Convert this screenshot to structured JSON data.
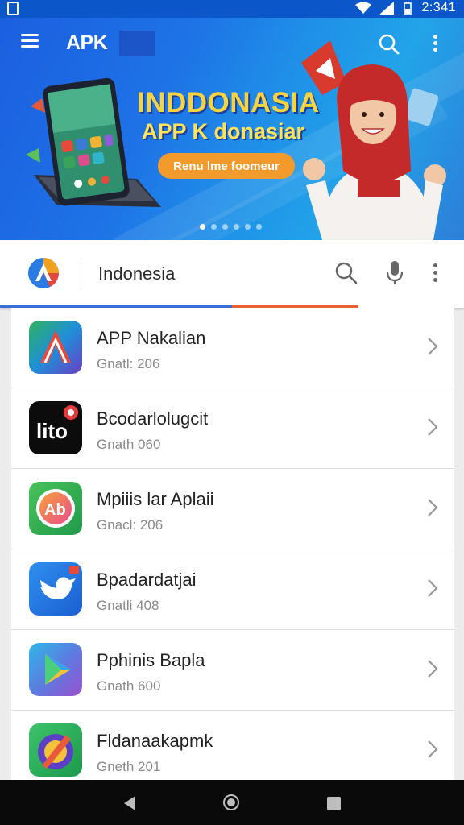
{
  "status_bar": {
    "time": "2:341"
  },
  "banner": {
    "logo": "APK",
    "headline": "INDDONASIA",
    "subline": "APP K donasiar",
    "button_label": "Renu lme foomeur",
    "slides": 6,
    "active_slide": 1
  },
  "search": {
    "query": "Indonesia"
  },
  "apps": [
    {
      "name": "APP Nakalian",
      "meta": "Gnatl: 206",
      "icon": "app-a-icon"
    },
    {
      "name": "Bcodarlolugcit",
      "meta": "Gnath 060",
      "icon": "lito-icon"
    },
    {
      "name": "Mpiiis lar Aplaii",
      "meta": "Gnacl: 206",
      "icon": "ab-circle-icon"
    },
    {
      "name": "Bpadardatjai",
      "meta": "Gnatli 408",
      "icon": "bird-icon"
    },
    {
      "name": "Pphinis Bapla",
      "meta": "Gnath 600",
      "icon": "play-icon"
    },
    {
      "name": "Fldanaakapmk",
      "meta": "Gneth 201",
      "icon": "compass-pen-icon"
    }
  ],
  "colors": {
    "accent_blue": "#3a6fd6",
    "accent_orange": "#e8632e",
    "banner_blue": "#1b5fe0"
  }
}
